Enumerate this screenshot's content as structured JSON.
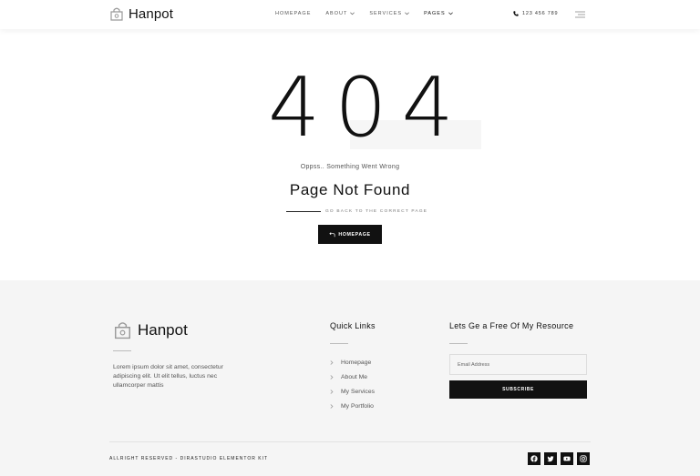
{
  "header": {
    "logo_text": "Hanpot",
    "nav": [
      {
        "label": "HOMEPAGE",
        "has_dropdown": false,
        "active": false
      },
      {
        "label": "ABOUT",
        "has_dropdown": true,
        "active": false
      },
      {
        "label": "SERVICES",
        "has_dropdown": true,
        "active": false
      },
      {
        "label": "PAGES",
        "has_dropdown": true,
        "active": true
      }
    ],
    "phone": "123 456 789"
  },
  "error": {
    "code": "404",
    "subtitle": "Oppss.. Something Went Wrong",
    "title": "Page Not Found",
    "go_back_text": "GO BACK TO THE CORRECT PAGE",
    "button_label": "HOMEPAGE"
  },
  "footer": {
    "logo_text": "Hanpot",
    "description": "Lorem ipsum dolor sit amet, consectetur adipiscing elit. Ut elit tellus, luctus nec ullamcorper mattis",
    "quick_links": {
      "title": "Quick Links",
      "items": [
        "Homepage",
        "About Me",
        "My Services",
        "My Portfolio"
      ]
    },
    "resource": {
      "title": "Lets Ge a Free Of My Resource",
      "email_placeholder": "Email Address",
      "subscribe_label": "SUBSCRIBE"
    },
    "copyright": "ALLRIGHT RESERVED - DIRASTUDIO ELEMENTOR KIT",
    "socials": [
      "facebook-icon",
      "twitter-icon",
      "youtube-icon",
      "instagram-icon"
    ]
  },
  "colors": {
    "accent": "#111111",
    "footer_bg": "#f5f5f5",
    "text_muted": "#555555"
  }
}
